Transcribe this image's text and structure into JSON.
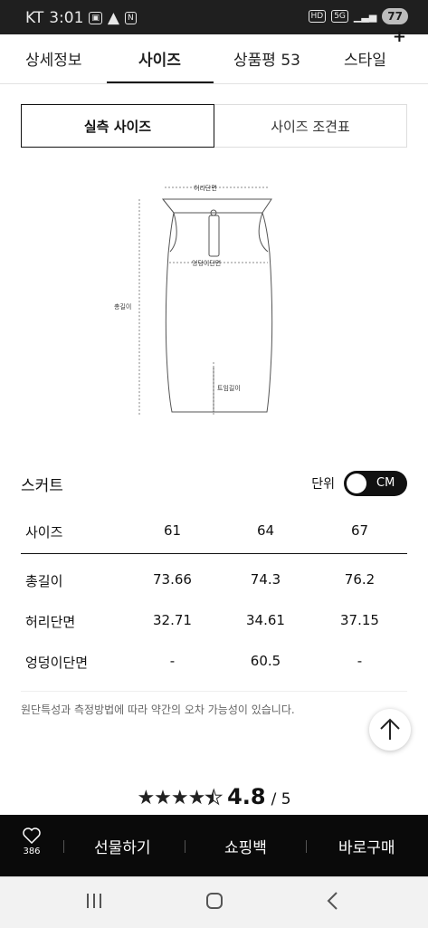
{
  "status": {
    "carrier": "KT",
    "time": "3:01",
    "battery": "77",
    "hd": "HD",
    "net": "5G"
  },
  "tabs": [
    {
      "label": "상세정보"
    },
    {
      "label": "사이즈"
    },
    {
      "label": "상품평 53"
    },
    {
      "label": "스타일"
    }
  ],
  "segment": {
    "left": "실측 사이즈",
    "right": "사이즈 조견표"
  },
  "diagram": {
    "waist": "허리단면",
    "hip": "엉덩이단면",
    "total": "총길이",
    "slit": "트임길이"
  },
  "section": {
    "title": "스커트",
    "unit_label": "단위",
    "unit_value": "CM"
  },
  "table": {
    "headers": [
      "사이즈",
      "61",
      "64",
      "67"
    ],
    "rows": [
      [
        "총길이",
        "73.66",
        "74.3",
        "76.2"
      ],
      [
        "허리단면",
        "32.71",
        "34.61",
        "37.15"
      ],
      [
        "엉덩이단면",
        "-",
        "60.5",
        "-"
      ]
    ]
  },
  "note": "원단특성과 측정방법에 따라 약간의 오차 가능성이 있습니다.",
  "rating": {
    "score": "4.8",
    "out_of": "/ 5",
    "stars": 4.5
  },
  "bottom": {
    "wish_count": "386",
    "gift": "선물하기",
    "bag": "쇼핑백",
    "buy": "바로구매"
  },
  "icons": [
    "heart-icon",
    "scroll-top-icon",
    "plus-icon",
    "recent-apps-icon",
    "home-icon",
    "back-icon"
  ]
}
